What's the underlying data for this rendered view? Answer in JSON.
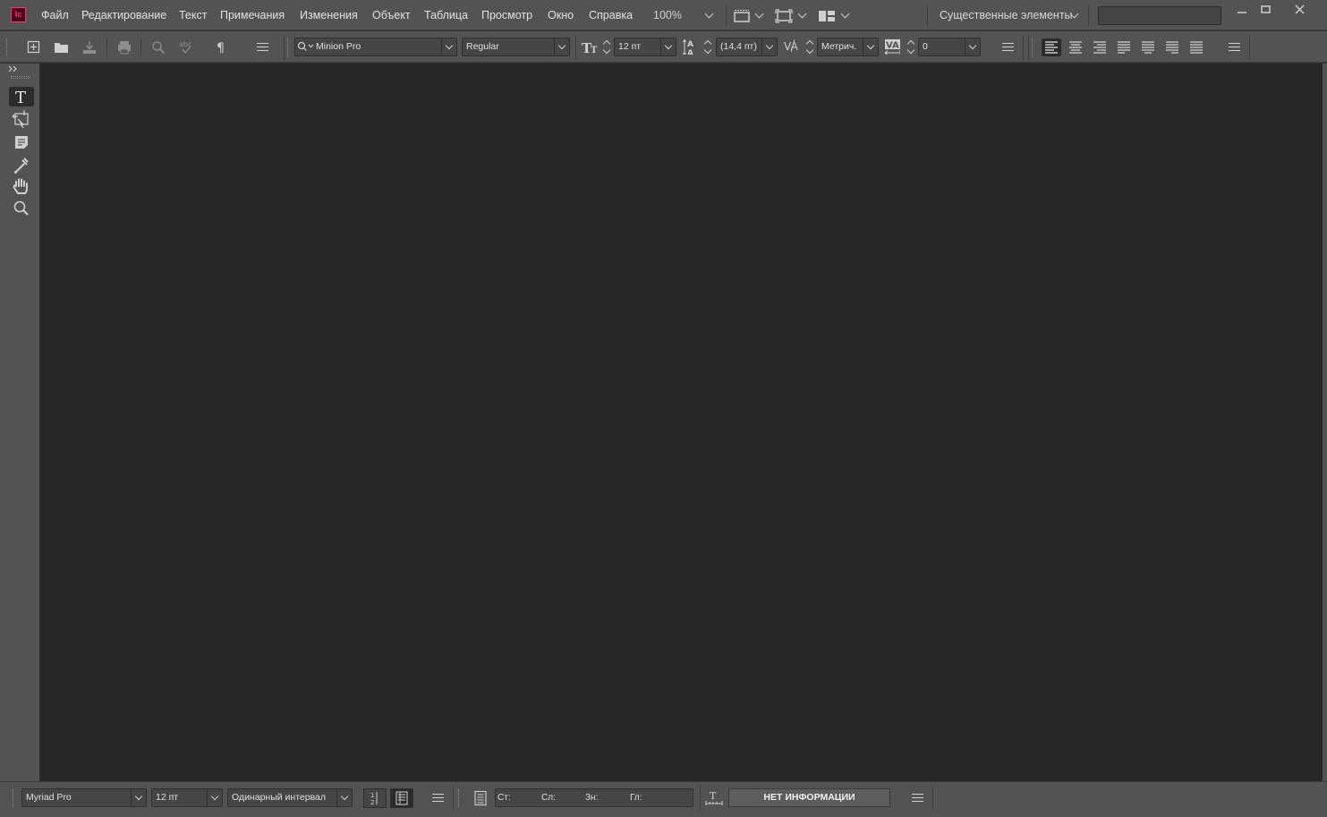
{
  "app": {
    "logo_text": "Ic"
  },
  "menu": {
    "items": [
      "Файл",
      "Редактирование",
      "Текст",
      "Примечания",
      "Изменения",
      "Объект",
      "Таблица",
      "Просмотр",
      "Окно",
      "Справка"
    ],
    "zoom": "100%",
    "workspace": "Существенные элементы",
    "search_placeholder": ""
  },
  "control": {
    "font_family": "Minion Pro",
    "font_style": "Regular",
    "font_size": "12 пт",
    "leading": "(14,4 пт)",
    "kerning": "Метрич.",
    "tracking": "0",
    "alignments": [
      "align-left",
      "align-center",
      "align-right",
      "justify-left",
      "justify-center",
      "justify-right",
      "justify-all"
    ],
    "active_alignment": "align-left"
  },
  "tools": [
    "type-tool",
    "position-tool",
    "note-tool",
    "eyedropper-tool",
    "hand-tool",
    "zoom-tool"
  ],
  "status": {
    "font_family": "Myriad Pro",
    "font_size": "12 пт",
    "line_spacing": "Одинарный интервал",
    "stat_pages": "Ст:",
    "stat_lines": "Сл:",
    "stat_chars": "Зн:",
    "stat_depth": "Гл:",
    "info_label": "НЕТ ИНФОРМАЦИИ"
  },
  "colors": {
    "accent": "#ff3366",
    "canvas": "#262626",
    "panel": "#535353"
  }
}
